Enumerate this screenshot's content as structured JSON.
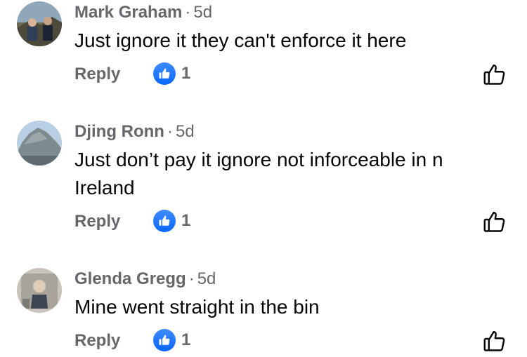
{
  "comments": [
    {
      "author": "Mark Graham",
      "separator": "·",
      "time": "5d",
      "text": "Just ignore it they can't enforce it here",
      "reply_label": "Reply",
      "reaction_count": "1",
      "reaction_icon": "thumbs-up-icon",
      "like_icon": "thumbs-up-outline-icon"
    },
    {
      "author": "Djing Ronn",
      "separator": "·",
      "time": "5d",
      "text": "Just don’t pay it ignore not inforceable in n Ireland",
      "reply_label": "Reply",
      "reaction_count": "1",
      "reaction_icon": "thumbs-up-icon",
      "like_icon": "thumbs-up-outline-icon"
    },
    {
      "author": "Glenda Gregg",
      "separator": "·",
      "time": "5d",
      "text": "Mine went straight in the bin",
      "reply_label": "Reply",
      "reaction_count": "1",
      "reaction_icon": "thumbs-up-icon",
      "like_icon": "thumbs-up-outline-icon"
    }
  ],
  "colors": {
    "secondary_text": "#65676b",
    "primary_text": "#050505",
    "like_blue": "#0866ff"
  }
}
